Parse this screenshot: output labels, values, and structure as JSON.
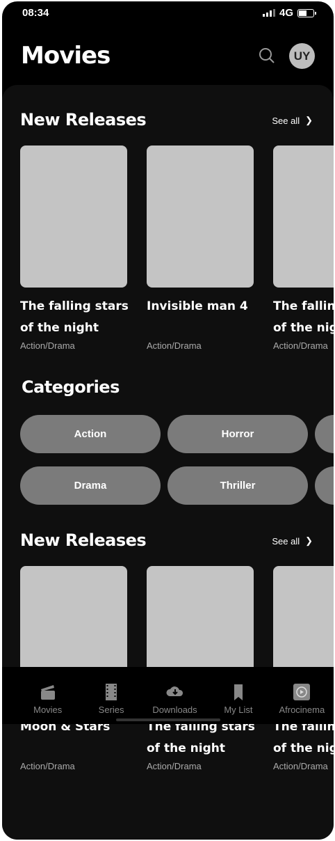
{
  "status": {
    "time": "08:34",
    "network": "4G"
  },
  "header": {
    "title": "Movies",
    "avatar_initials": "UY"
  },
  "sections": [
    {
      "title": "New Releases",
      "see_all": "See all",
      "movies": [
        {
          "title1": "The falling stars",
          "title2": "of the night",
          "genre": "Action/Drama"
        },
        {
          "title1": "Invisible man 4",
          "title2": "",
          "genre": "Action/Drama"
        },
        {
          "title1": "The falling stars",
          "title2": "of the night",
          "genre": "Action/Drama"
        }
      ]
    },
    {
      "title": "New Releases",
      "see_all": "See all",
      "movies": [
        {
          "title1": "Moon & Stars",
          "title2": "",
          "genre": "Action/Drama"
        },
        {
          "title1": "The falling stars",
          "title2": "of the night",
          "genre": "Action/Drama"
        },
        {
          "title1": "The falling stars",
          "title2": "of the night",
          "genre": "Action/Drama"
        }
      ]
    }
  ],
  "categories": {
    "title": "Categories",
    "row1": [
      "Action",
      "Horror",
      ""
    ],
    "row2": [
      "Drama",
      "Thriller",
      ""
    ]
  },
  "nav": [
    {
      "label": "Movies",
      "icon": "clapperboard-icon"
    },
    {
      "label": "Series",
      "icon": "film-strip-icon"
    },
    {
      "label": "Downloads",
      "icon": "cloud-download-icon"
    },
    {
      "label": "My List",
      "icon": "bookmark-icon"
    },
    {
      "label": "Afrocinema",
      "icon": "afrocinema-icon"
    }
  ]
}
